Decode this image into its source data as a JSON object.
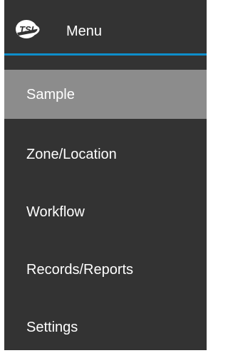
{
  "header": {
    "logo_icon": "tsi-logo-icon",
    "title": "Menu",
    "accent_color": "#0e8ecb"
  },
  "nav": {
    "items": [
      {
        "label": "Sample",
        "active": true
      },
      {
        "label": "Zone/Location",
        "active": false
      },
      {
        "label": "Workflow",
        "active": false
      },
      {
        "label": "Records/Reports",
        "active": false
      },
      {
        "label": "Settings",
        "active": false
      }
    ]
  },
  "colors": {
    "panel_bg": "#333333",
    "active_bg": "#8c8c8c",
    "text": "#ffffff"
  }
}
